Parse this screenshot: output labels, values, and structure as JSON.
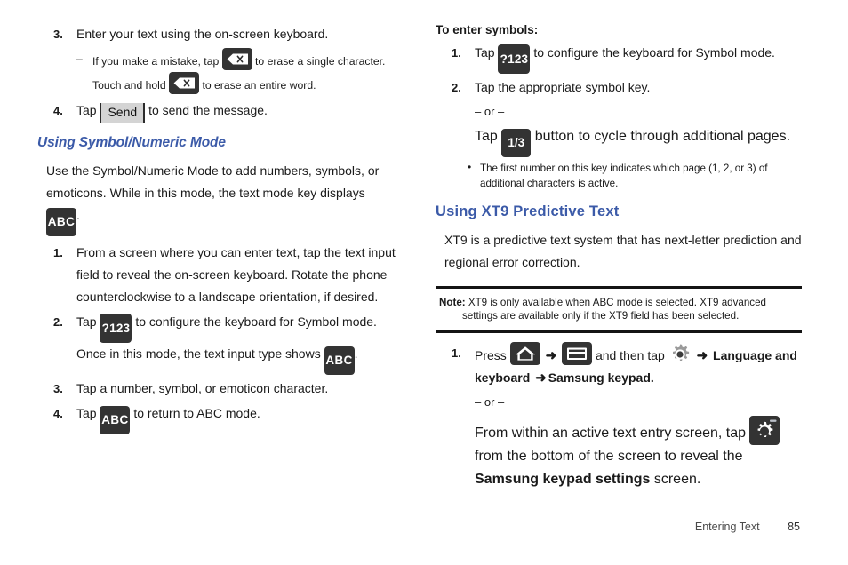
{
  "left_column": {
    "step3": {
      "num": "3.",
      "text": "Enter your text using the on-screen keyboard."
    },
    "dash1": {
      "dash": "–",
      "text_before": "If you make a mistake, tap",
      "key1": "backspace-key",
      "text_mid": "to erase a single character. Touch and hold",
      "key2": "backspace-key",
      "text_after": "to erase an entire word."
    },
    "step4": {
      "num": "4.",
      "text_before": "Tap",
      "button_label": "Send",
      "text_after": "to send the message."
    },
    "heading": "Using Symbol/Numeric Mode",
    "intro": {
      "line1": "Use the Symbol/Numeric Mode to add numbers, symbols, or",
      "line2": "emoticons. While in this mode, the text mode key displays",
      "key": "ABC",
      "trailing": "."
    },
    "steps": [
      {
        "num": "1.",
        "text": "From a screen where you can enter text, tap the text input field to reveal the on-screen keyboard. Rotate the phone counterclockwise to a landscape orientation, if desired."
      },
      {
        "num": "2.",
        "text_before": "Tap",
        "key": "?123",
        "text_mid": "to configure the keyboard for Symbol mode. Once in this mode, the text input type shows",
        "key2": "ABC",
        "text_after": "."
      },
      {
        "num": "3.",
        "text": "Tap a number, symbol, or emoticon character."
      },
      {
        "num": "4.",
        "text_before": "Tap",
        "key": "ABC",
        "text_after": "to return to ABC mode."
      }
    ]
  },
  "right_column": {
    "sub_heading": "To enter symbols:",
    "steps": [
      {
        "num": "1.",
        "text_before": "Tap",
        "key": "?123",
        "text_after": "to configure the keyboard for Symbol mode."
      },
      {
        "num": "2.",
        "text": "Tap the appropriate symbol key."
      }
    ],
    "or_label": "– or –",
    "cycle": {
      "text_before": "Tap",
      "key": "1/3",
      "text_after": "button to cycle through additional pages."
    },
    "bullet": {
      "marker": "•",
      "text": "The first number on this key indicates which page (1, 2, or 3) of additional characters is active."
    },
    "heading": "Using XT9 Predictive Text",
    "intro": "XT9 is a predictive text system that has next-letter prediction and regional error correction.",
    "note": {
      "label": "Note:",
      "line1": "XT9 is only available when ABC mode is selected. XT9 advanced",
      "line2": "settings are available only if the XT9 field has been selected."
    },
    "step1": {
      "num": "1.",
      "text_before": "Press",
      "icon_home": "home-icon",
      "arrow1": "➜",
      "icon_menu": "menu-icon",
      "text_mid": "and then tap",
      "icon_gear": "gear-icon",
      "arrow2": "➜",
      "bold1": "Language and keyboard",
      "arrow3": "➜",
      "bold2": "Samsung keypad",
      "period": "."
    },
    "or_label2": "– or –",
    "alt": {
      "text_before": "From within an active text entry screen, tap",
      "icon_gear": "gear-settings-key",
      "text_mid": "from the bottom of the screen to reveal the",
      "bold": "Samsung keypad settings",
      "text_after": "screen."
    }
  },
  "footer": {
    "section_title": "Entering Text",
    "page_number": "85"
  },
  "colors": {
    "heading_blue": "#3b5aa8",
    "key_dark": "#333333",
    "send_gray": "#d4d4d4",
    "rule_black": "#141414"
  }
}
